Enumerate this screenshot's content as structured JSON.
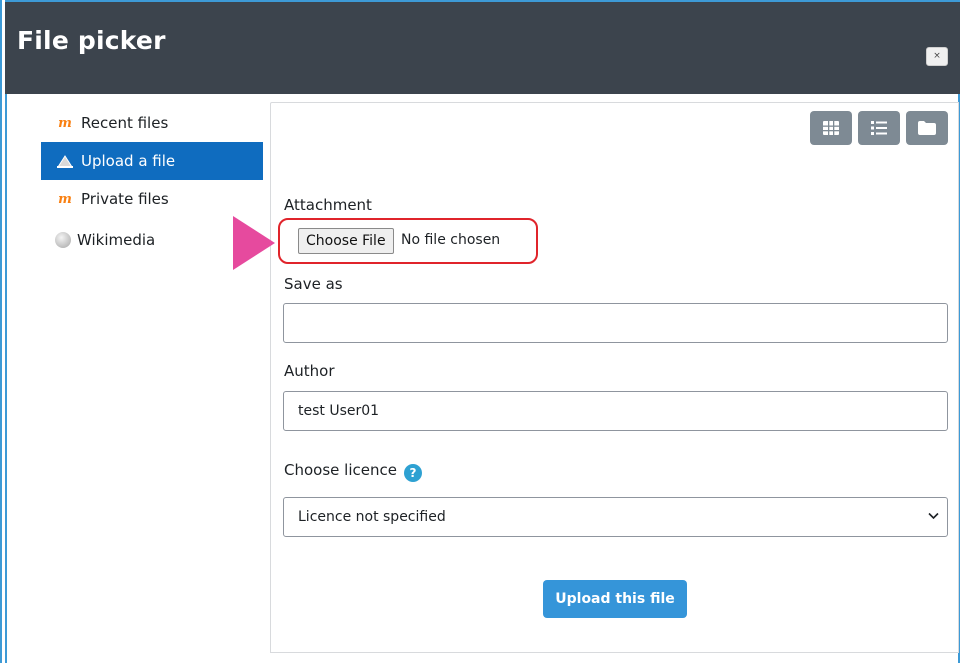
{
  "dialog": {
    "title": "File picker",
    "close_label": "×"
  },
  "sidebar": {
    "items": [
      {
        "label": "Recent files",
        "icon": "moodle-icon",
        "active": false
      },
      {
        "label": "Upload a file",
        "icon": "upload-icon",
        "active": true
      },
      {
        "label": "Private files",
        "icon": "moodle-icon",
        "active": false
      },
      {
        "label": "Wikimedia",
        "icon": "wikimedia-icon",
        "active": false
      }
    ]
  },
  "toolbar": {
    "views": [
      {
        "icon": "grid-view-icon"
      },
      {
        "icon": "list-view-icon"
      },
      {
        "icon": "folder-view-icon"
      }
    ]
  },
  "form": {
    "attachment_label": "Attachment",
    "choose_file_label": "Choose File",
    "no_file_text": "No file chosen",
    "save_as_label": "Save as",
    "save_as_value": "",
    "author_label": "Author",
    "author_value": "test User01",
    "licence_label": "Choose licence",
    "help_glyph": "?",
    "licence_value": "Licence not specified",
    "upload_label": "Upload this file"
  },
  "colors": {
    "titlebar": "#3c444d",
    "active_item": "#0f6cbf",
    "accent_border": "#3d9ad6",
    "highlight_border": "#e0242b",
    "pointer_arrow": "#e64a9e",
    "upload_button": "#3595d9",
    "view_button": "#7e8a94"
  }
}
